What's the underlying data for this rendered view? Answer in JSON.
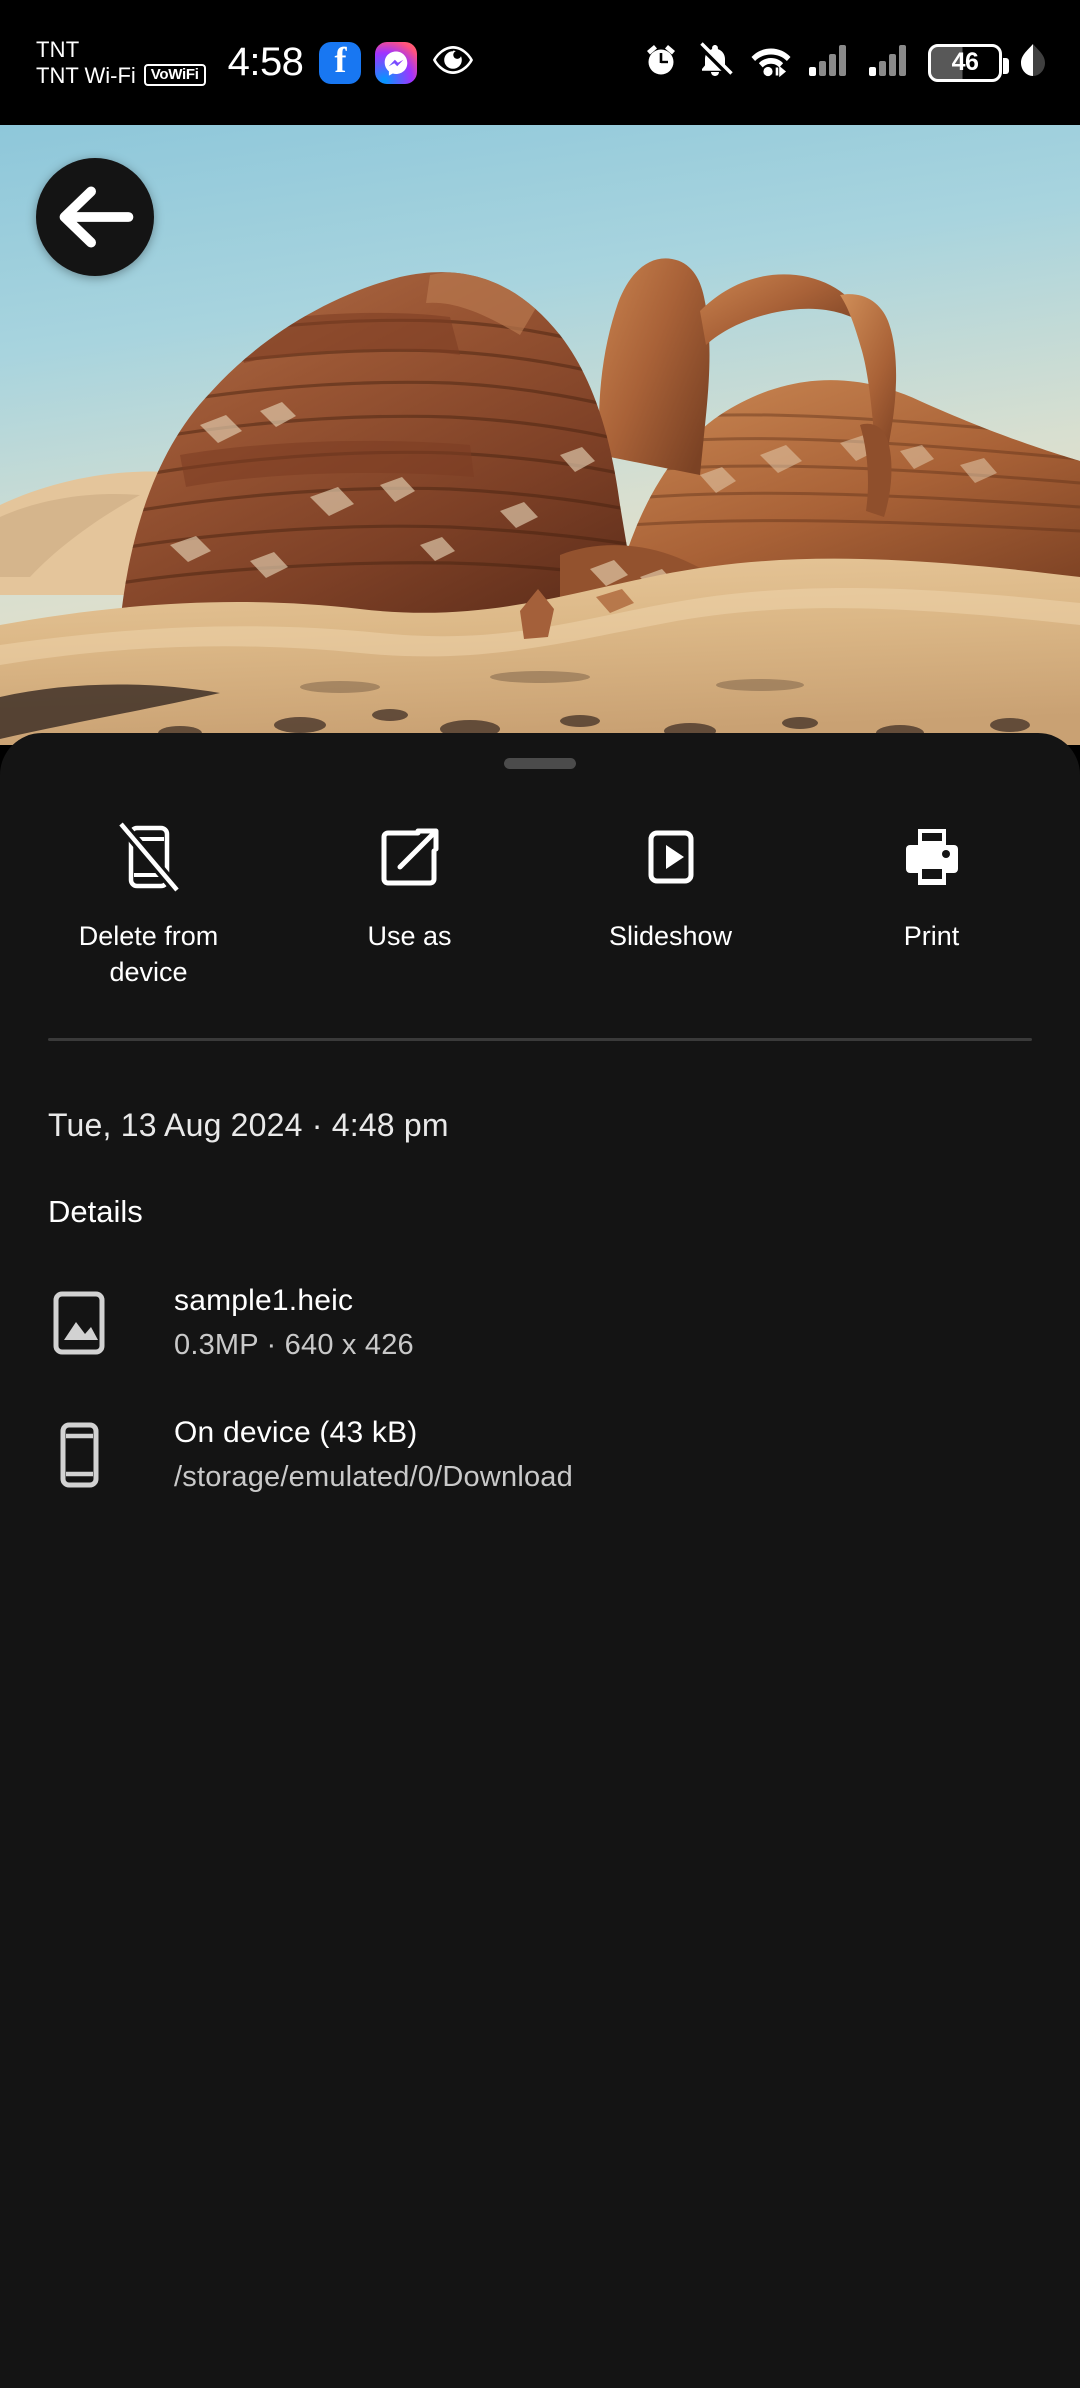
{
  "statusbar": {
    "carrier_line1": "TNT",
    "carrier_line2": "TNT Wi-Fi",
    "vowifi_badge": "VoWiFi",
    "time": "4:58",
    "app_icons": [
      "facebook-icon",
      "messenger-icon",
      "eye-icon"
    ],
    "right_icons": [
      "alarm-icon",
      "notifications-off-icon",
      "wifi-icon",
      "signal-sim1-icon",
      "signal-sim2-icon"
    ],
    "battery_level": "46",
    "battery_saver_icon": "leaf-icon"
  },
  "viewer": {
    "back_button_icon": "arrow-left-icon",
    "photo_alt": "desert sandstone arch rock formation at dusk"
  },
  "sheet": {
    "grabber": "drag-handle",
    "actions": [
      {
        "label": "Delete from device",
        "icon": "phone-slash-icon"
      },
      {
        "label": "Use as",
        "icon": "open-in-new-icon"
      },
      {
        "label": "Slideshow",
        "icon": "play-box-icon"
      },
      {
        "label": "Print",
        "icon": "printer-icon"
      }
    ],
    "datetime": "Tue, 13 Aug 2024  ·  4:48 pm",
    "details_heading": "Details",
    "details_rows": [
      {
        "icon": "image-icon",
        "primary": "sample1.heic",
        "secondary": "0.3MP  ·  640 x 426"
      },
      {
        "icon": "phone-icon",
        "primary": "On device (43 kB)",
        "secondary": "/storage/emulated/0/Download"
      }
    ]
  },
  "colors": {
    "sheet_background": "#141414",
    "screen_background": "#000000",
    "divider": "#3a3a3a",
    "primary_text": "#ffffff",
    "secondary_text": "#c9c9c9",
    "facebook_blue": "#1877F2"
  }
}
